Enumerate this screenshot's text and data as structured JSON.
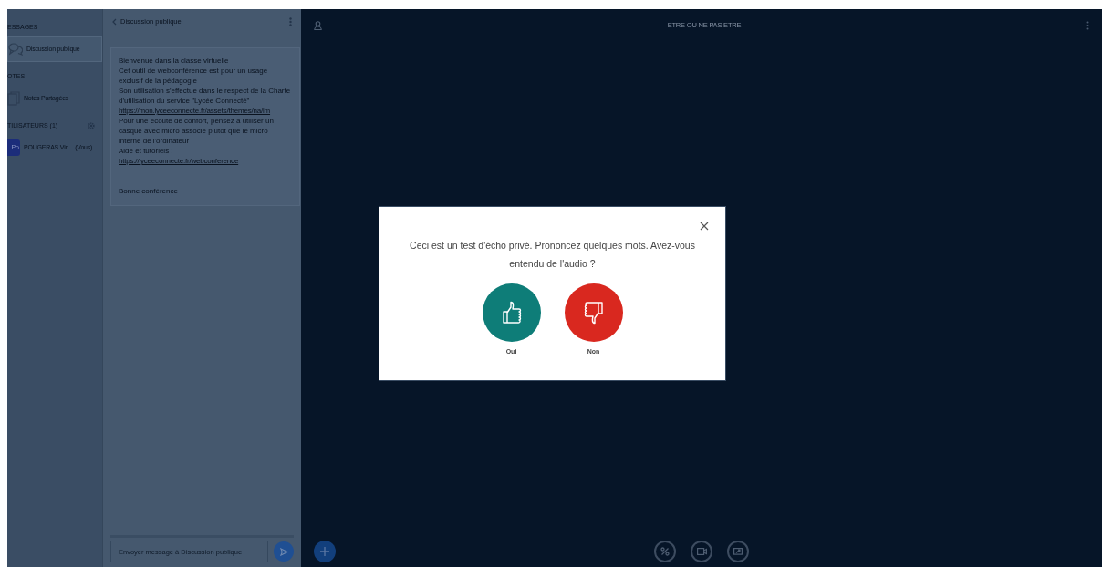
{
  "sidebar": {
    "sections": [
      {
        "title": "ESSAGES",
        "kind": "plain",
        "items": [
          {
            "label": "Discussion publique",
            "kind": "chat",
            "selected": true
          }
        ]
      },
      {
        "title": "OTES",
        "kind": "plain",
        "items": [
          {
            "label": "Notes Partagées",
            "kind": "notes",
            "selected": false
          }
        ]
      },
      {
        "title": "TILISATEURS (1)",
        "kind": "users",
        "items": [
          {
            "label": "POUGERAS Vin... (Vous)",
            "kind": "user",
            "avatar": "Po",
            "selected": false
          }
        ]
      }
    ]
  },
  "chat": {
    "title": "Discussion publique",
    "message": {
      "lines": [
        {
          "kind": "text",
          "text": "Bienvenue dans la classe virtuelle"
        },
        {
          "kind": "text",
          "text": "Cet outil de webconférence est pour un usage exclusif de la pédagogie"
        },
        {
          "kind": "text",
          "text": "Son utilisation s'effectue dans le respect de la Charte d'utilisation du service \"Lycée Connecté\""
        },
        {
          "kind": "link",
          "text": "https://mon.lyceeconnecte.fr/assets/themes/na/im"
        },
        {
          "kind": "text",
          "text": "Pour une écoute de confort, pensez à utiliser un casque avec micro associé plutôt que le micro interne de l'ordinateur"
        },
        {
          "kind": "text",
          "text": "Aide et tutoriels :"
        },
        {
          "kind": "link",
          "text": "https://lyceeconnecte.fr/webconference"
        }
      ],
      "closing": "Bonne conférence"
    },
    "input": {
      "placeholder": "Envoyer message à Discussion publique"
    }
  },
  "main": {
    "title": "ETRE OU NE PAS ETRE"
  },
  "modal": {
    "text": "Ceci est un test d'écho privé. Prononcez quelques mots. Avez-vous entendu de l'audio ?",
    "buttons": [
      {
        "label": "Oui",
        "kind": "yes"
      },
      {
        "label": "Non",
        "kind": "no"
      }
    ]
  }
}
